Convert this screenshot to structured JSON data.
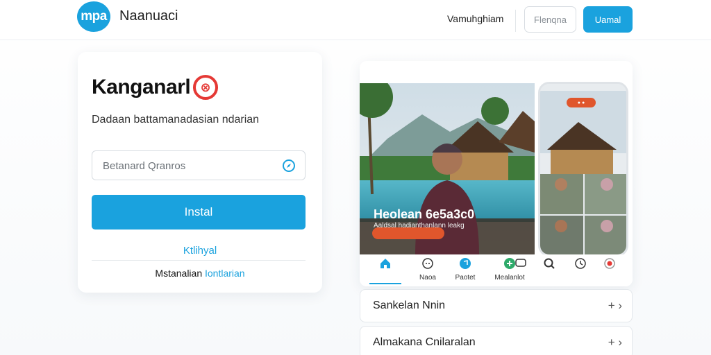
{
  "header": {
    "logo_text": "mpa",
    "brand": "Naanuaci",
    "nav_link": "Vamuhghiam",
    "outline_button": "Flenqna",
    "primary_button": "Uamal"
  },
  "card": {
    "title": "Kanganarl",
    "subtitle": "Dadaan battamanadasian ndarian",
    "search_placeholder": "Betanard Qranros",
    "install_label": "Instal",
    "link_text": "Ktlihyal",
    "footer_text": "Mstanalian",
    "footer_accent": "Iontlarian"
  },
  "media": {
    "scene_title": "Heolean 6e5a3c0",
    "scene_subtitle": "Aaldsal hadianthanlann leakg",
    "tabs": [
      {
        "label": "",
        "icon": "home-icon"
      },
      {
        "label": "Naoa",
        "icon": "chat-icon"
      },
      {
        "label": "Paotet",
        "icon": "music-icon"
      },
      {
        "label": "Mealanlot",
        "icon": "plus-icon"
      },
      {
        "label": "",
        "icon": "message-icon"
      },
      {
        "label": "",
        "icon": "search-icon"
      },
      {
        "label": "",
        "icon": "timer-icon"
      },
      {
        "label": "",
        "icon": "record-icon"
      }
    ]
  },
  "accordion": [
    {
      "label": "Sankelan Nnin"
    },
    {
      "label": "Almakana Cnilaralan"
    }
  ],
  "colors": {
    "accent": "#1aa2de",
    "alert": "#e53935",
    "orange": "#e0562c"
  }
}
